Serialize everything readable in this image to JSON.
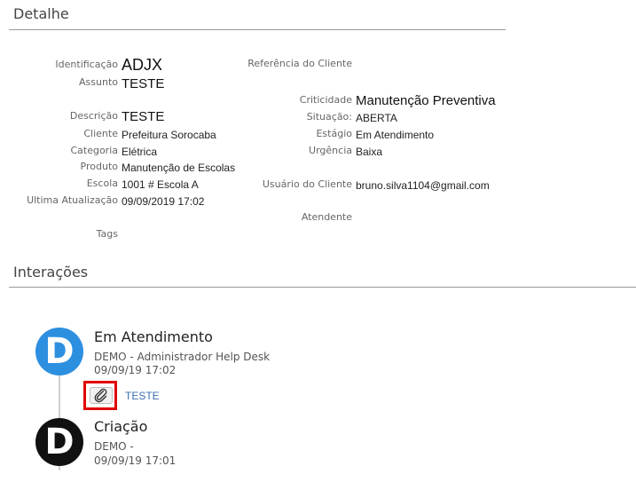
{
  "detalhe": {
    "title": "Detalhe",
    "left": {
      "identificacao": {
        "label": "Identificação",
        "value": "ADJX"
      },
      "assunto": {
        "label": "Assunto",
        "value": "TESTE"
      },
      "descricao": {
        "label": "Descrição",
        "value": "TESTE"
      },
      "cliente": {
        "label": "Cliente",
        "value": "Prefeitura Sorocaba"
      },
      "categoria": {
        "label": "Categoria",
        "value": "Elétrica"
      },
      "produto": {
        "label": "Produto",
        "value": "Manutenção de Escolas"
      },
      "escola": {
        "label": "Escola",
        "value": "1001 # Escola A"
      },
      "ultima_atualizacao": {
        "label": "Ultima Atualização",
        "value": "09/09/2019 17:02"
      },
      "tags": {
        "label": "Tags",
        "value": ""
      }
    },
    "right": {
      "referencia_cliente": {
        "label": "Referência do Cliente",
        "value": ""
      },
      "criticidade": {
        "label": "Criticidade",
        "value": "Manutenção Preventiva"
      },
      "situacao": {
        "label": "Situação:",
        "value": "ABERTA"
      },
      "estagio": {
        "label": "Estágio",
        "value": "Em Atendimento"
      },
      "urgencia": {
        "label": "Urgência",
        "value": "Baixa"
      },
      "usuario_cliente": {
        "label": "Usuário do Cliente",
        "value": "bruno.silva1104@gmail.com"
      },
      "atendente": {
        "label": "Atendente",
        "value": ""
      }
    }
  },
  "interacoes": {
    "title": "Interações",
    "items": [
      {
        "avatar_letter": "D",
        "avatar_color": "#2d8fe0",
        "title": "Em Atendimento",
        "author": "DEMO - Administrador Help Desk",
        "datetime": "09/09/19 17:02",
        "attachment": {
          "icon": "paperclip-icon",
          "link_text": "TESTE"
        }
      },
      {
        "avatar_letter": "D",
        "avatar_color": "#111111",
        "title": "Criação",
        "author": "DEMO -",
        "datetime": "09/09/19 17:01"
      }
    ]
  },
  "colors": {
    "highlight": "#e00000",
    "link": "#3a6fb0"
  }
}
